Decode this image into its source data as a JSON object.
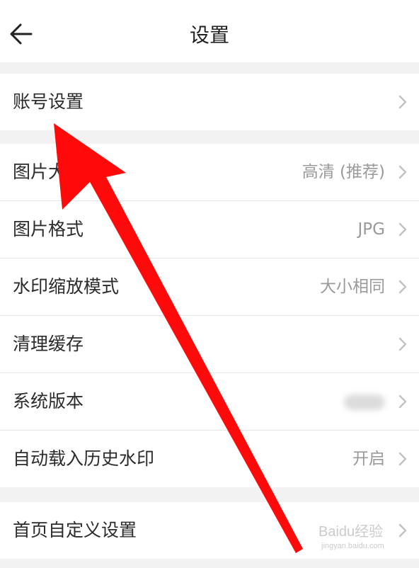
{
  "header": {
    "title": "设置",
    "back_icon": "arrow-left-icon"
  },
  "groups": [
    {
      "rows": [
        {
          "label": "账号设置",
          "value": "",
          "icon": "chevron-right-icon"
        }
      ]
    },
    {
      "rows": [
        {
          "label": "图片大",
          "value": "高清 (推荐)",
          "icon": "chevron-right-icon"
        },
        {
          "label": "图片格式",
          "value": "JPG",
          "icon": "chevron-right-icon"
        },
        {
          "label": "水印缩放模式",
          "value": "大小相同",
          "icon": "chevron-right-icon"
        },
        {
          "label": "清理缓存",
          "value": "",
          "icon": "chevron-right-icon"
        },
        {
          "label": "系统版本",
          "value": "",
          "icon": "chevron-right-icon"
        },
        {
          "label": "自动载入历史水印",
          "value": "开启",
          "icon": "chevron-right-icon"
        }
      ]
    },
    {
      "rows": [
        {
          "label": "首页自定义设置",
          "value": "",
          "icon": "chevron-right-icon"
        }
      ]
    }
  ],
  "watermark": {
    "text": "Baidu经验",
    "subtext": "jingyan.baidu.com"
  },
  "colors": {
    "background": "#f2f2f2",
    "row_background": "#ffffff",
    "annotation_arrow": "#ff1010",
    "secondary_text": "#9a9a9a"
  }
}
